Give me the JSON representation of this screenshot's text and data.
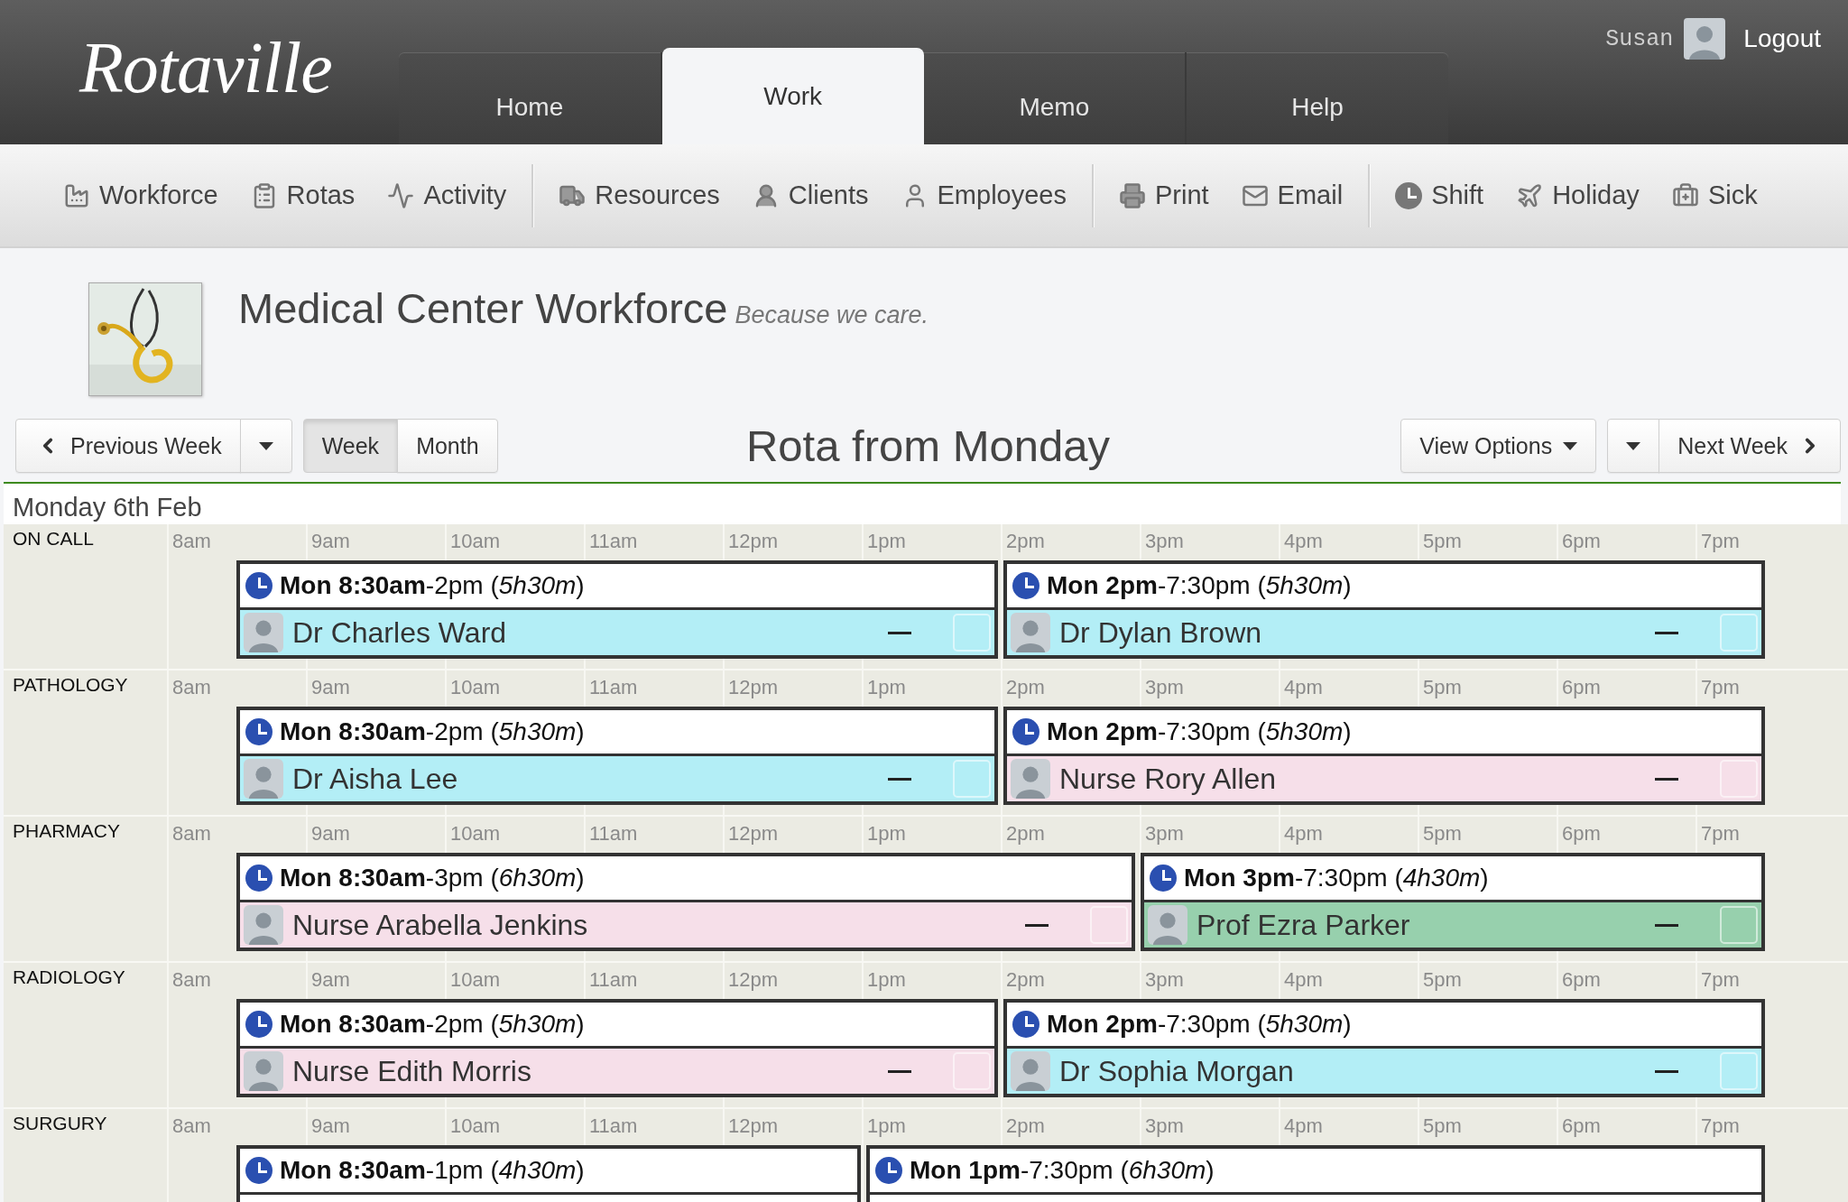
{
  "header": {
    "logo": "Rotaville",
    "tabs": [
      {
        "label": "Home",
        "selected": false
      },
      {
        "label": "Work",
        "selected": true
      },
      {
        "label": "Memo",
        "selected": false
      },
      {
        "label": "Help",
        "selected": false
      }
    ],
    "user": {
      "name": "Susan",
      "action": "Logout"
    }
  },
  "toolbar": {
    "groups": [
      [
        {
          "label": "Workforce"
        },
        {
          "label": "Rotas"
        },
        {
          "label": "Activity"
        }
      ],
      [
        {
          "label": "Resources"
        },
        {
          "label": "Clients"
        },
        {
          "label": "Employees"
        }
      ],
      [
        {
          "label": "Print"
        },
        {
          "label": "Email"
        }
      ],
      [
        {
          "label": "Shift"
        },
        {
          "label": "Holiday"
        },
        {
          "label": "Sick"
        }
      ]
    ]
  },
  "organisation": {
    "name": "Medical Center Workforce",
    "tagline": "Because we care."
  },
  "controls": {
    "previous": "Previous Week",
    "views": [
      {
        "label": "Week",
        "selected": true
      },
      {
        "label": "Month",
        "selected": false
      }
    ],
    "title": "Rota from Monday",
    "view_options": "View Options",
    "next": "Next Week"
  },
  "rota": {
    "date": "Monday 6th Feb",
    "departments": [
      {
        "name": "ON CALL",
        "hours": [
          "8am",
          "9am",
          "10am",
          "11am",
          "12pm",
          "1pm",
          "2pm",
          "3pm",
          "4pm",
          "5pm",
          "6pm",
          "7pm"
        ],
        "shifts": [
          {
            "time": "**Mon 8:30am**-2pm (*5h30m*)",
            "person": "Dr Charles Ward",
            "color": "#b3eef6",
            "checked": false
          },
          {
            "time": "**Mon 2pm**-7:30pm (*5h30m*)",
            "person": "Dr Dylan Brown",
            "color": "#b3eef6",
            "checked": false
          }
        ]
      },
      {
        "name": "PATHOLOGY",
        "hours": [
          "8am",
          "9am",
          "10am",
          "11am",
          "12pm",
          "1pm",
          "2pm",
          "3pm",
          "4pm",
          "5pm",
          "6pm",
          "7pm"
        ],
        "shifts": [
          {
            "time": "**Mon 8:30am**-2pm (*5h30m*)",
            "person": "Dr Aisha Lee",
            "color": "#b3eef6",
            "checked": false
          },
          {
            "time": "**Mon 2pm**-7:30pm (*5h30m*)",
            "person": "Nurse Rory Allen",
            "color": "#f6dfe9",
            "checked": false
          }
        ]
      },
      {
        "name": "PHARMACY",
        "hours": [
          "8am",
          "9am",
          "10am",
          "11am",
          "12pm",
          "1pm",
          "2pm",
          "3pm",
          "4pm",
          "5pm",
          "6pm",
          "7pm"
        ],
        "shifts": [
          {
            "time": "**Mon 8:30am**-3pm (*6h30m*)",
            "person": "Nurse Arabella Jenkins",
            "color": "#f6dfe9",
            "checked": false
          },
          {
            "time": "**Mon 3pm**-7:30pm (*4h30m*)",
            "person": "Prof Ezra Parker",
            "color": "#97d0ad",
            "checked": false
          }
        ]
      },
      {
        "name": "RADIOLOGY",
        "hours": [
          "8am",
          "9am",
          "10am",
          "11am",
          "12pm",
          "1pm",
          "2pm",
          "3pm",
          "4pm",
          "5pm",
          "6pm",
          "7pm"
        ],
        "shifts": [
          {
            "time": "**Mon 8:30am**-2pm (*5h30m*)",
            "person": "Nurse Edith Morris",
            "color": "#f6dfe9",
            "checked": false
          },
          {
            "time": "**Mon 2pm**-7:30pm (*5h30m*)",
            "person": "Dr Sophia Morgan",
            "color": "#b3eef6",
            "checked": false
          }
        ]
      },
      {
        "name": "SURGURY",
        "hours": [
          "8am",
          "9am",
          "10am",
          "11am",
          "12pm",
          "1pm",
          "2pm",
          "3pm",
          "4pm",
          "5pm",
          "6pm",
          "7pm"
        ],
        "shifts": [
          {
            "time": "**Mon 8:30am**-1pm (*4h30m*)"
          },
          {
            "time": "**Mon 1pm**-7:30pm (*6h30m*)"
          }
        ]
      }
    ]
  }
}
